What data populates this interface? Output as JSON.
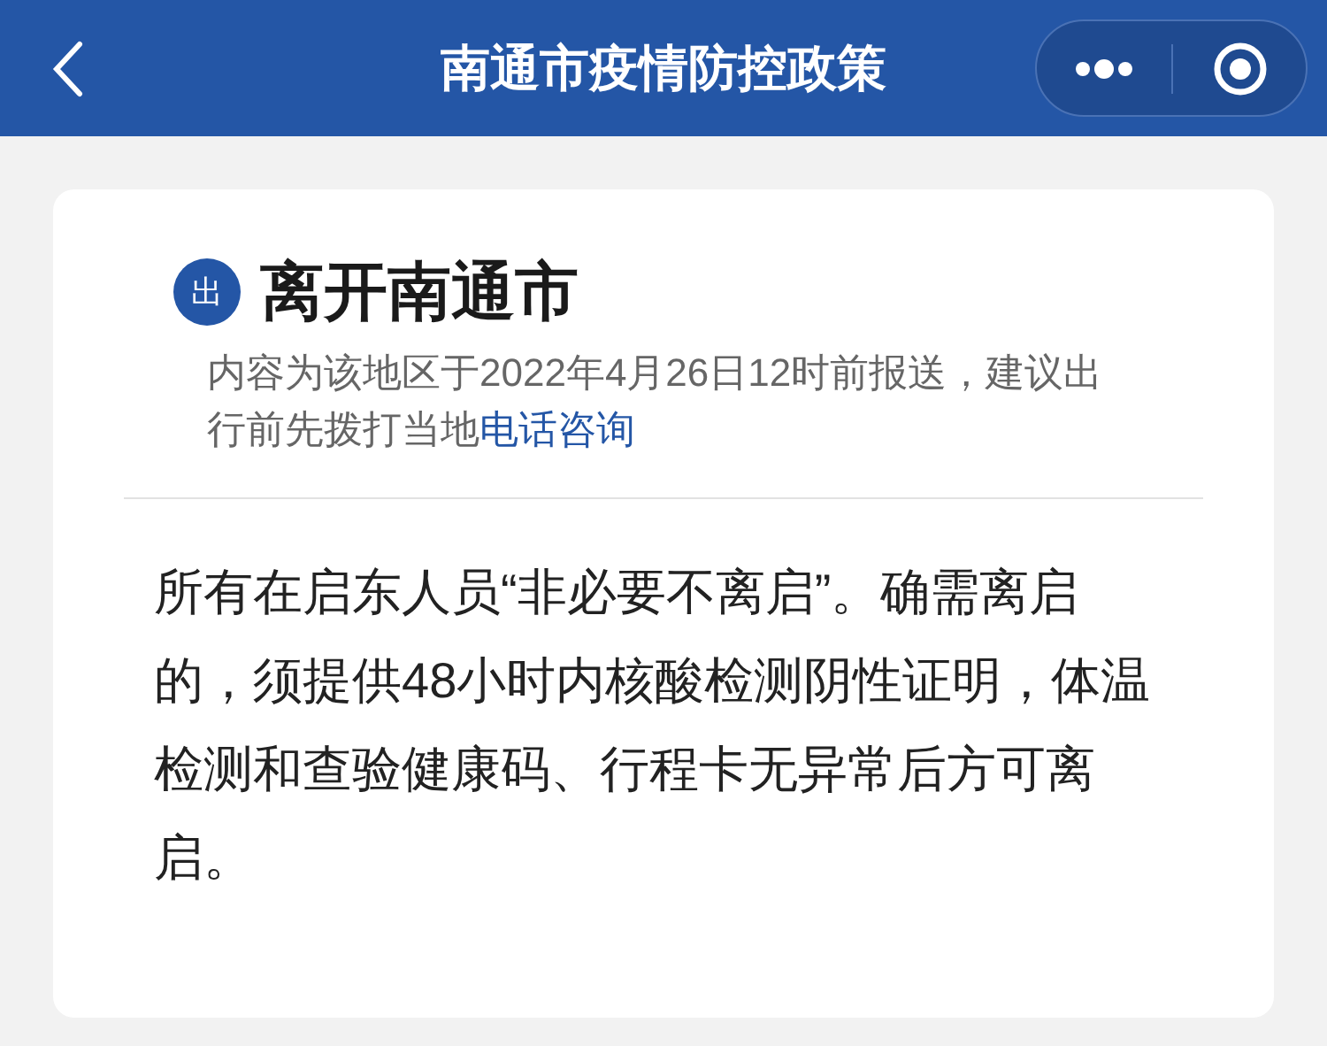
{
  "header": {
    "title": "南通市疫情防控政策"
  },
  "card": {
    "badge": "出",
    "title": "离开南通市",
    "note": {
      "text": "内容为该地区于2022年4月26日12时前报送，建议出行前先拨打当地",
      "link": "电话咨询"
    },
    "body": "所有在启东人员“非必要不离启”。确需离启的，须提供48小时内核酸检测阴性证明，体温检测和查验健康码、行程卡无异常后方可离启。"
  }
}
